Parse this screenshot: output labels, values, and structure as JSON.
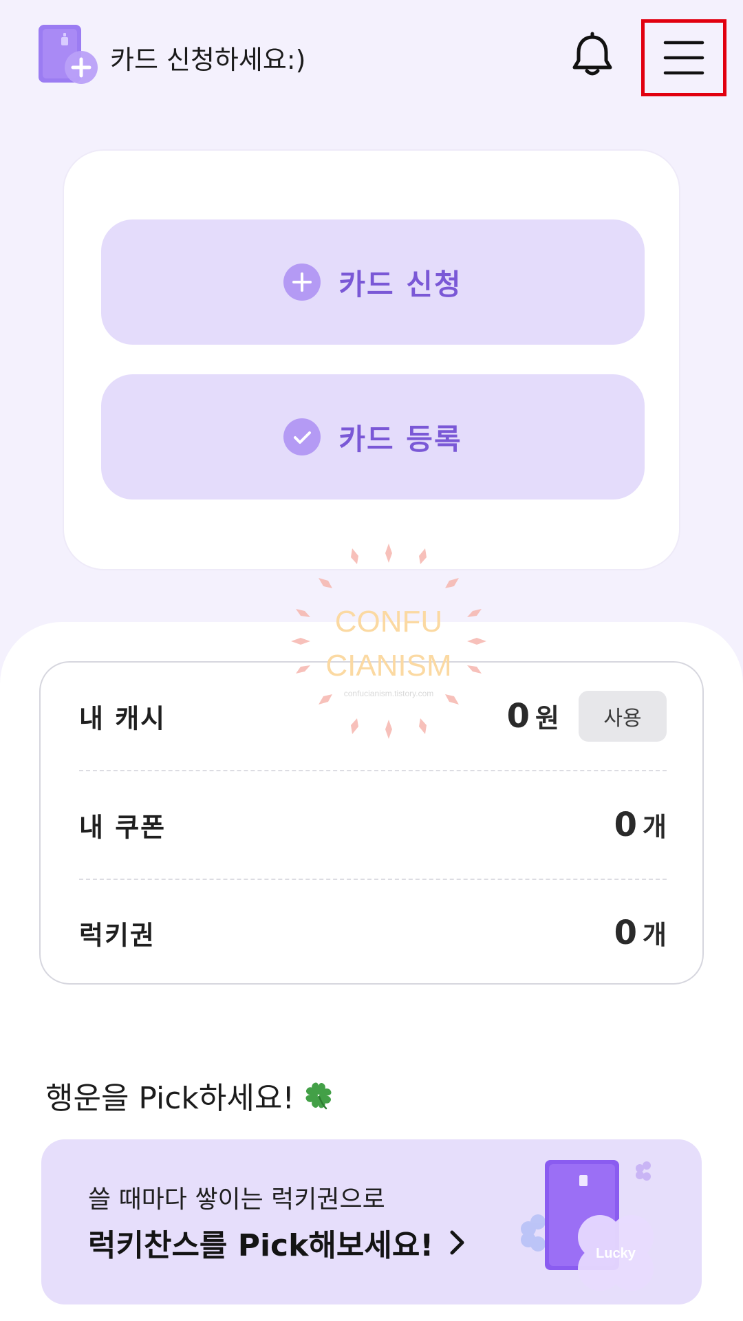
{
  "header": {
    "greeting": "카드 신청하세요:)",
    "logo_icon": "card-add-icon",
    "bell_icon": "bell-icon",
    "menu_icon": "hamburger-menu-icon"
  },
  "actions": {
    "apply_label": "카드 신청",
    "register_label": "카드 등록"
  },
  "wallet": {
    "cash_label": "내 캐시",
    "cash_value": "0",
    "cash_unit": "원",
    "use_button": "사용",
    "coupon_label": "내 쿠폰",
    "coupon_value": "0",
    "coupon_unit": "개",
    "lucky_ticket_label": "럭키권",
    "lucky_ticket_value": "0",
    "lucky_ticket_unit": "개"
  },
  "watermark": {
    "line1": "CONFU",
    "line2": "CIANISM",
    "url": "confucianism.tistory.com"
  },
  "lucky": {
    "section_title": "행운을 Pick하세요!",
    "banner_sub": "쓸 때마다 쌓이는 럭키권으로",
    "banner_main": "럭키찬스를 Pick해보세요!",
    "art_label": "Lucky"
  },
  "colors": {
    "accent": "#7a58d6",
    "button_bg": "#e4dcfb",
    "page_bg": "#f4f1fd",
    "highlight_box": "#e1000f"
  }
}
